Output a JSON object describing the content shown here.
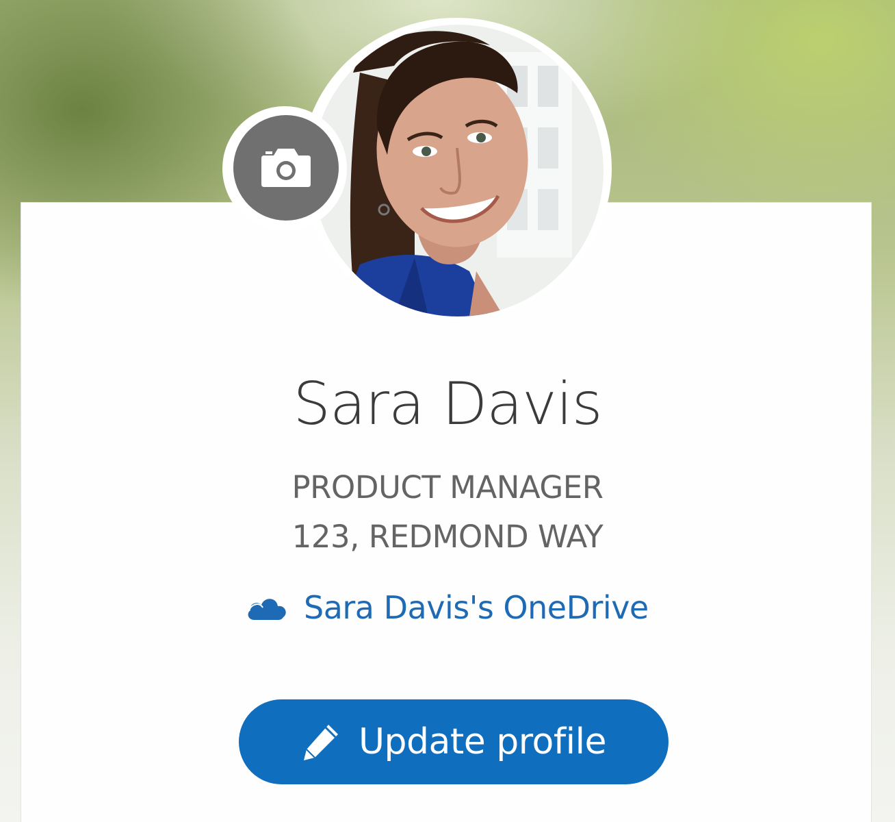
{
  "profile": {
    "name": "Sara Davis",
    "title": "PRODUCT MANAGER",
    "address": "123, REDMOND WAY",
    "onedrive_label": "Sara Davis's OneDrive",
    "update_button_label": "Update profile"
  },
  "icons": {
    "camera": "camera-icon",
    "onedrive": "cloud-icon",
    "edit": "pencil-icon"
  },
  "colors": {
    "accent": "#106ebe",
    "link": "#1f6ab4",
    "camera_button": "#707070",
    "name_text": "#3b3b3b",
    "info_text": "#646464"
  }
}
